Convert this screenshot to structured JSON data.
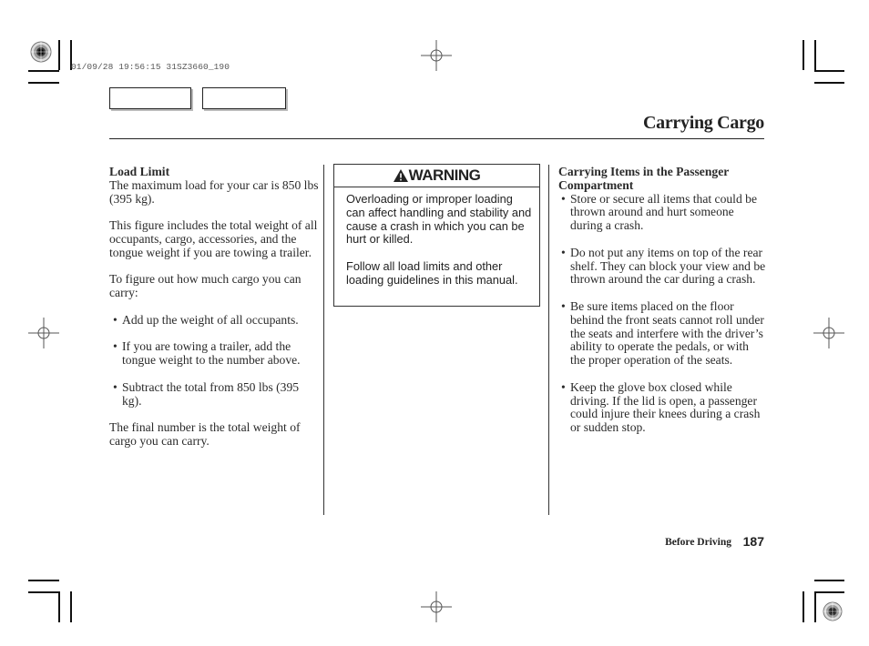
{
  "print_stamp": "01/09/28 19:56:15 31SZ3660_190",
  "nav_buttons": [
    {
      "label": ""
    },
    {
      "label": ""
    }
  ],
  "page_title": "Carrying Cargo",
  "left_column": {
    "heading": "Load Limit",
    "intro": "The maximum load for your car is 850 lbs (395 kg).",
    "paragraph_2": "This figure includes the total weight of all occupants, cargo, accessories, and the tongue weight if you are towing a trailer.",
    "paragraph_3": "To figure out how much cargo you can carry:",
    "bullets": [
      "Add up the weight of all occupants.",
      "If you are towing a trailer, add the tongue weight to the number above.",
      "Subtract the total from 850 lbs (395 kg)."
    ],
    "closing": "The final number is the total weight of cargo you can carry."
  },
  "warning_box": {
    "title": "WARNING",
    "paragraphs": [
      "Overloading or improper loading can affect handling and stability and cause a crash in which you can be hurt or killed.",
      "Follow all load limits and other loading guidelines in this manual."
    ]
  },
  "right_column": {
    "heading": "Carrying Items in the Passenger Compartment",
    "bullets": [
      "Store or secure all items that could be thrown around and hurt someone during a crash.",
      "Do not put any items on top of the rear shelf. They can block your view and be thrown around the car during a crash.",
      "Be sure items placed on the floor behind the front seats cannot roll under the seats and interfere with the driver’s ability to operate the pedals, or with the proper operation of the seats.",
      "Keep the glove box closed while driving. If the lid is open, a passenger could injure their knees during a crash or sudden stop."
    ]
  },
  "footer": {
    "section": "Before Driving",
    "page_number": "187"
  }
}
